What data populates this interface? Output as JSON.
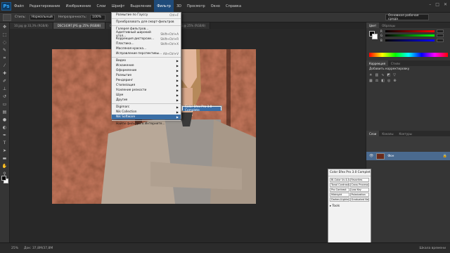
{
  "menubar": {
    "logo": "Ps",
    "items": [
      "Файл",
      "Редактирование",
      "Изображение",
      "Слои",
      "Шрифт",
      "Выделение",
      "Фильтр",
      "3D",
      "Просмотр",
      "Окно",
      "Справка"
    ],
    "active_index": 6
  },
  "optbar": {
    "mode_label": "Стиль:",
    "mode_value": "Нормальный",
    "opacity_label": "Непрозрачность:",
    "opacity_value": "100%",
    "workspace": "Основная рабочая среда"
  },
  "tabs": [
    {
      "label": "10.jpg @ 33,3% (RGB/8)",
      "active": false
    },
    {
      "label": "DSC14397.JPG @ 25% (RGB/8)",
      "active": true
    },
    {
      "label": "DSC14398.JPG @ 25% (RGB/8)",
      "active": false
    },
    {
      "label": "DSC14399.JPG @ 25% (RGB/8)",
      "active": false
    }
  ],
  "filter_menu": {
    "items": [
      {
        "label": "Размытие по Гауссу",
        "shortcut": "Ctrl+F",
        "type": "item"
      },
      {
        "type": "sep"
      },
      {
        "label": "Преобразовать для смарт-фильтров",
        "shortcut": "",
        "type": "item"
      },
      {
        "type": "sep"
      },
      {
        "label": "Галерея фильтров...",
        "shortcut": "",
        "type": "item"
      },
      {
        "label": "Адаптивный широкий угол...",
        "shortcut": "Shift+Ctrl+A",
        "type": "item"
      },
      {
        "label": "Коррекция дисторсии...",
        "shortcut": "Shift+Ctrl+R",
        "type": "item"
      },
      {
        "label": "Пластика...",
        "shortcut": "Shift+Ctrl+X",
        "type": "item"
      },
      {
        "label": "Масляная краска...",
        "shortcut": "",
        "type": "item"
      },
      {
        "label": "Исправление перспективы...",
        "shortcut": "Alt+Ctrl+V",
        "type": "item"
      },
      {
        "type": "sep"
      },
      {
        "label": "Видео",
        "shortcut": "",
        "type": "sub"
      },
      {
        "label": "Искажение",
        "shortcut": "",
        "type": "sub"
      },
      {
        "label": "Оформление",
        "shortcut": "",
        "type": "sub"
      },
      {
        "label": "Размытие",
        "shortcut": "",
        "type": "sub"
      },
      {
        "label": "Рендеринг",
        "shortcut": "",
        "type": "sub"
      },
      {
        "label": "Стилизация",
        "shortcut": "",
        "type": "sub"
      },
      {
        "label": "Усиление резкости",
        "shortcut": "",
        "type": "sub"
      },
      {
        "label": "Шум",
        "shortcut": "",
        "type": "sub"
      },
      {
        "label": "Другие",
        "shortcut": "",
        "type": "sub"
      },
      {
        "type": "sep"
      },
      {
        "label": "Digimarc",
        "shortcut": "",
        "type": "sub"
      },
      {
        "label": "Nik Collection",
        "shortcut": "",
        "type": "sub"
      },
      {
        "label": "Nik Software",
        "shortcut": "",
        "type": "sub",
        "highlight": true
      },
      {
        "type": "sep"
      },
      {
        "label": "Найти фильтры в Интернете...",
        "shortcut": "",
        "type": "item"
      }
    ],
    "submenu_item": "Color Efex Pro 3.0 Complete"
  },
  "panels": {
    "color_tabs": [
      "Цвет",
      "Образцы"
    ],
    "slider_labels": [
      "R",
      "G",
      "B"
    ],
    "adjust_tabs": [
      "Коррекция",
      "Стили"
    ],
    "adjust_title": "Добавить корректировку",
    "layers_tabs": [
      "Слои",
      "Каналы",
      "Контуры"
    ],
    "layer_name": "Фон"
  },
  "cep": {
    "title": "Color Efex Pro 3.0 Complete",
    "buttons": [
      "Bi-Color Us & Filt",
      "Favorites",
      "Tonal Contrast",
      "Cross Processing",
      "Pro Contrast",
      "Low Key",
      "Midnight",
      "Polarization",
      "Darken/Lighten",
      "Graduated Neutral"
    ],
    "tools_label": "Tools",
    "footer": [
      "Help",
      "Settings"
    ]
  },
  "status": {
    "zoom": "25%",
    "doc": "Док: 37,8M/37,8M",
    "label": "Шкала времени"
  },
  "colors": {
    "accent": "#3a6ea5"
  }
}
